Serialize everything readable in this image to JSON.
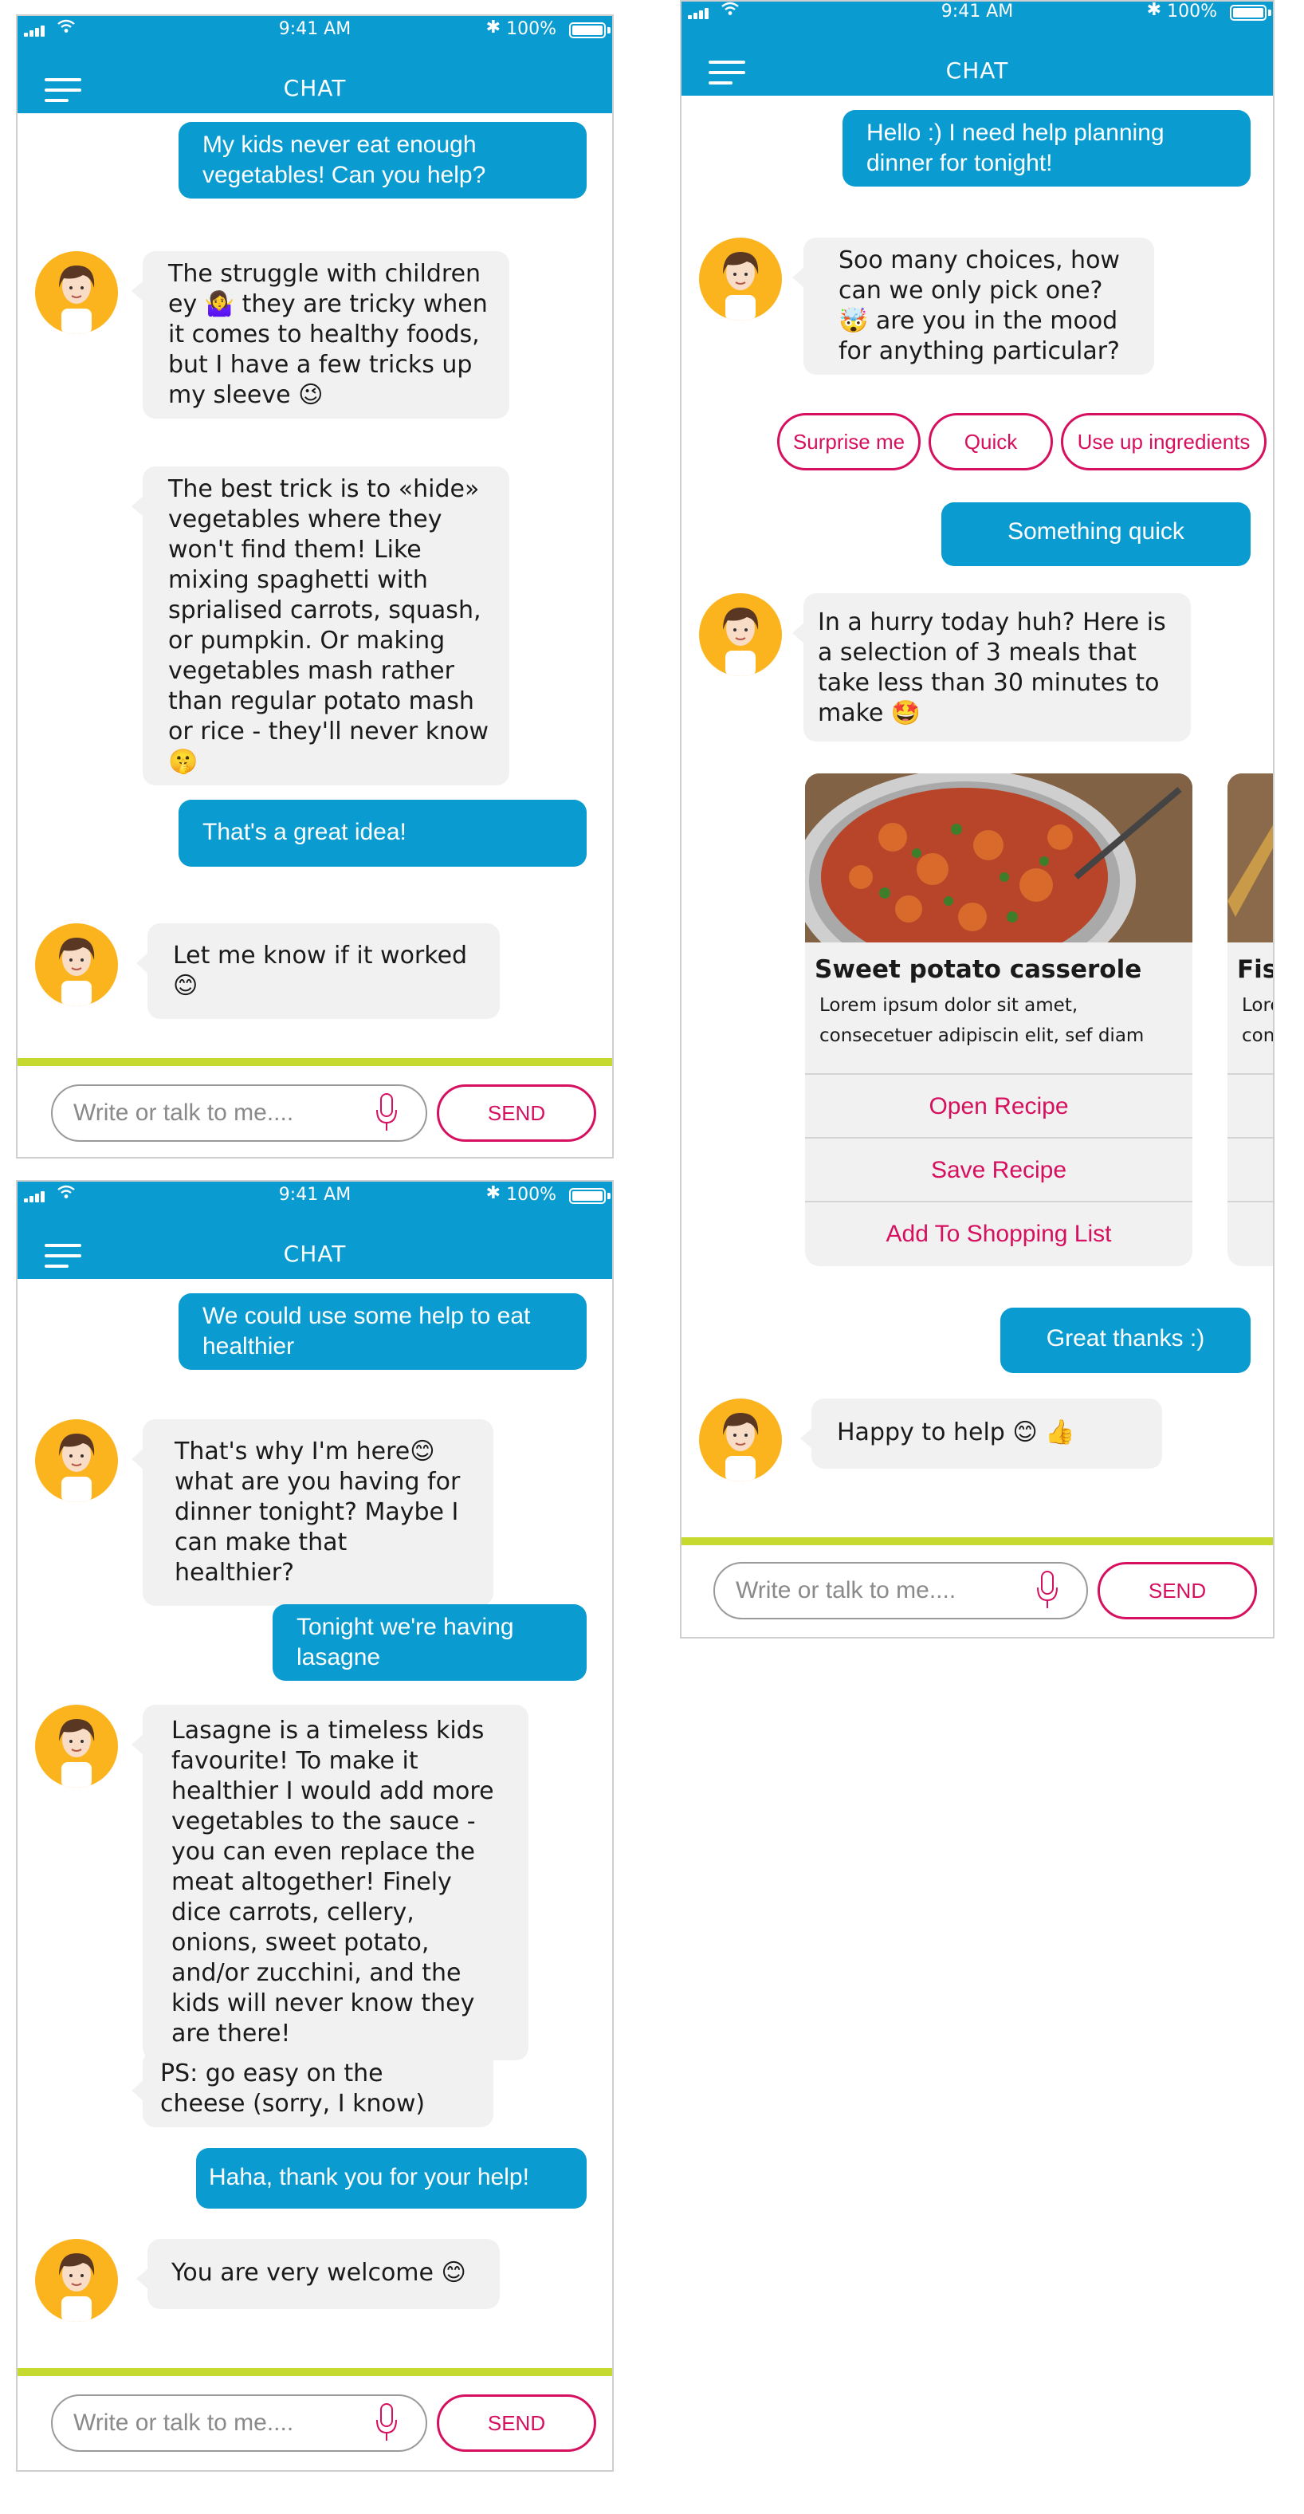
{
  "status_bar": {
    "time": "9:41 AM",
    "battery": "100%"
  },
  "header": {
    "title": "CHAT"
  },
  "input": {
    "placeholder": "Write or talk to me....",
    "send_label": "SEND"
  },
  "screen1": {
    "messages": [
      {
        "from": "user",
        "text": "My kids never eat enough vegetables! Can you help?"
      },
      {
        "from": "bot",
        "text": "The struggle with children ey 🤷‍♀️ they are tricky when it comes to healthy foods, but I have a few tricks up my sleeve 😉"
      },
      {
        "from": "bot",
        "text": "The best trick is to «hide» vegetables where they won't find them! Like mixing spaghetti with sprialised carrots, squash, or pumpkin. Or making vegetables mash rather than regular potato mash or rice - they'll never know 🤫"
      },
      {
        "from": "user",
        "text": "That's a great idea!"
      },
      {
        "from": "bot",
        "text": "Let me know if it worked 😊"
      }
    ]
  },
  "screen2": {
    "messages": [
      {
        "from": "user",
        "text": "We could use some help to eat healthier"
      },
      {
        "from": "bot",
        "text": "That's why I'm here😊 what are you having for dinner tonight? Maybe I can make that healthier?"
      },
      {
        "from": "user",
        "text": "Tonight we're having lasagne"
      },
      {
        "from": "bot",
        "text": "Lasagne is a timeless kids favourite! To make it healthier I would add more vegetables to the sauce - you can even replace the meat altogether! Finely dice carrots, cellery, onions, sweet potato, and/or zucchini, and the kids will never know they are there!"
      },
      {
        "from": "bot",
        "text": "PS: go easy on the cheese (sorry, I know)"
      },
      {
        "from": "user",
        "text": "Haha, thank you for your help!"
      },
      {
        "from": "bot",
        "text": "You are very welcome 😊"
      }
    ]
  },
  "screen3": {
    "messages": [
      {
        "from": "user",
        "text": "Hello :) I need help planning dinner for tonight!"
      },
      {
        "from": "bot",
        "text": "Soo many choices, how can we only pick one? 🤯 are you in the mood for anything particular?"
      },
      {
        "from": "user",
        "text": "Something quick"
      },
      {
        "from": "bot",
        "text": "In a hurry today huh? Here is a selection of 3 meals that take less than 30 minutes to make 🤩"
      },
      {
        "from": "user",
        "text": "Great thanks :)"
      },
      {
        "from": "bot",
        "text": "Happy to help 😊 👍"
      }
    ],
    "quick_replies": [
      "Surprise me",
      "Quick",
      "Use up ingredients"
    ],
    "cards": [
      {
        "title": "Sweet potato casserole",
        "description": "Lorem ipsum dolor sit amet, consecetuer adipiscin elit, sef diam",
        "actions": [
          "Open Recipe",
          "Save Recipe",
          "Add To Shopping List"
        ]
      },
      {
        "title": "Fis",
        "description": "Lore con",
        "actions": []
      }
    ]
  },
  "colors": {
    "header": "#0a9bd0",
    "user_bubble": "#0a9bd0",
    "bot_bubble": "#f1f1f1",
    "accent": "#d6105f",
    "divider": "#c5d92e",
    "avatar": "#fbb41e"
  }
}
